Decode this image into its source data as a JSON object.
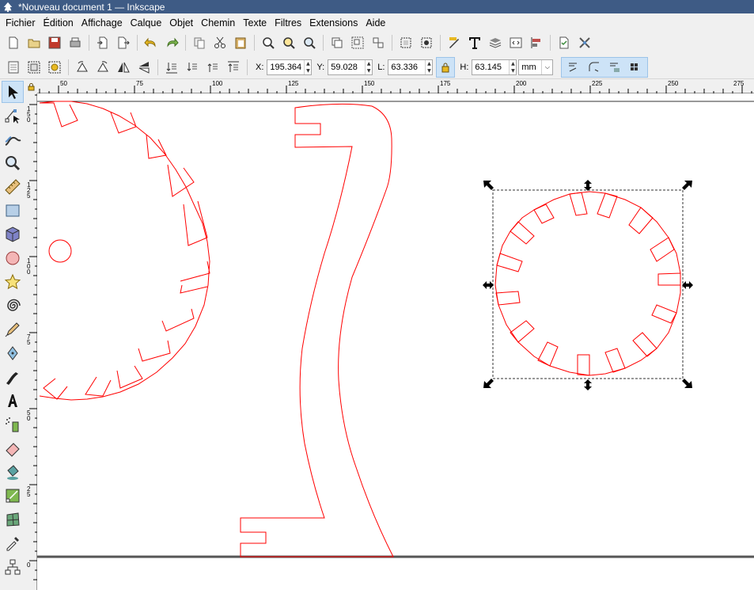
{
  "window": {
    "title": "*Nouveau document 1 — Inkscape"
  },
  "menu": [
    "Fichier",
    "Édition",
    "Affichage",
    "Calque",
    "Objet",
    "Chemin",
    "Texte",
    "Filtres",
    "Extensions",
    "Aide"
  ],
  "commands_bar": {
    "icons": [
      "new-document-icon",
      "open-icon",
      "save-icon",
      "print-icon",
      "import-icon",
      "export-icon",
      "undo-icon",
      "redo-icon",
      "copy-icon",
      "cut-icon",
      "paste-icon",
      "zoom-selection-icon",
      "zoom-drawing-icon",
      "zoom-page-icon",
      "duplicate-icon",
      "group-icon",
      "ungroup-icon",
      "node-editor-icon",
      "clone-icon",
      "fill-stroke-icon",
      "text-icon",
      "layers-icon",
      "xml-editor-icon",
      "align-icon",
      "document-properties-icon",
      "preferences-icon"
    ]
  },
  "selector_bar": {
    "x_label": "X:",
    "x_value": "195.364",
    "y_label": "Y:",
    "y_value": "59.028",
    "w_label": "L:",
    "w_value": "63.336",
    "h_label": "H:",
    "h_value": "63.145",
    "unit": "mm"
  },
  "toolbox": [
    "selector-tool",
    "node-tool",
    "tweak-tool",
    "zoom-tool",
    "measure-tool",
    "rectangle-tool",
    "3d-box-tool",
    "ellipse-tool",
    "star-tool",
    "spiral-tool",
    "pencil-tool",
    "pen-tool",
    "calligraphy-tool",
    "text-tool",
    "spray-tool",
    "eraser-tool",
    "paint-bucket-tool",
    "gradient-tool",
    "mesh-tool",
    "dropper-tool",
    "connector-tool"
  ],
  "hruler": {
    "labels": [
      "50",
      "75",
      "100",
      "125",
      "150",
      "175",
      "200",
      "225",
      "250",
      "275"
    ]
  },
  "vruler": {
    "labels": [
      "150",
      "125",
      "100",
      "75",
      "50",
      "25",
      "0"
    ]
  },
  "colors": {
    "titlebar": "#3e5b85",
    "path_stroke": "#ff0000",
    "selection_active": "#cde3f7"
  }
}
